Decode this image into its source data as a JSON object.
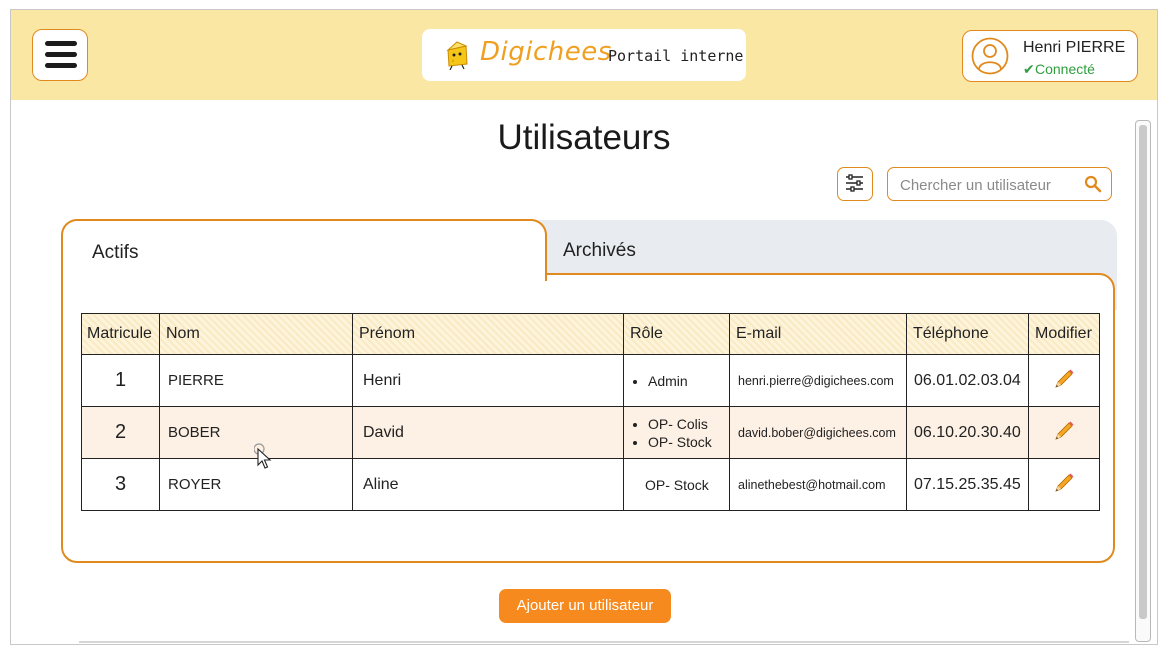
{
  "header": {
    "brand_name": "Digichees",
    "brand_subtitle": "Portail interne",
    "user": {
      "name": "Henri PIERRE",
      "status": "Connecté"
    }
  },
  "page": {
    "title": "Utilisateurs"
  },
  "toolbar": {
    "search_placeholder": "Chercher un utilisateur"
  },
  "tabs": [
    {
      "label": "Actifs",
      "active": true
    },
    {
      "label": "Archivés",
      "active": false
    }
  ],
  "table": {
    "columns": [
      "Matricule",
      "Nom",
      "Prénom",
      "Rôle",
      "E-mail",
      "Téléphone",
      "Modifier"
    ],
    "rows": [
      {
        "matricule": "1",
        "nom": "PIERRE",
        "prenom": "Henri",
        "roles": [
          "Admin"
        ],
        "email": "henri.pierre@digichees.com",
        "telephone": "06.01.02.03.04"
      },
      {
        "matricule": "2",
        "nom": "BOBER",
        "prenom": "David",
        "roles": [
          "OP- Colis",
          "OP- Stock"
        ],
        "email": "david.bober@digichees.com",
        "telephone": "06.10.20.30.40"
      },
      {
        "matricule": "3",
        "nom": "ROYER",
        "prenom": "Aline",
        "roles": [
          "OP- Stock"
        ],
        "email": "alinethebest@hotmail.com",
        "telephone": "07.15.25.35.45"
      }
    ]
  },
  "actions": {
    "add_user_label": "Ajouter un utilisateur"
  },
  "colors": {
    "accent": "#e08a1e",
    "header_bg": "#fbe7a4",
    "button": "#f68a1e",
    "status_ok": "#2e9e3e",
    "row_highlight": "#fdf0e4"
  },
  "icons": {
    "menu": "hamburger-icon",
    "avatar": "user-avatar-icon",
    "filter": "sliders-icon",
    "search": "search-icon",
    "edit": "pencil-icon"
  }
}
